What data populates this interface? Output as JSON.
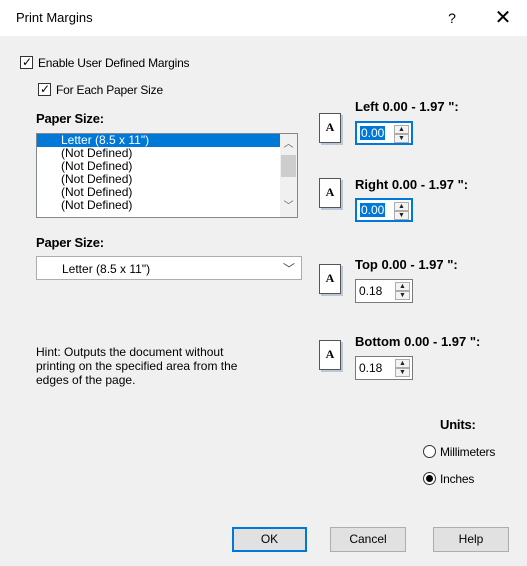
{
  "window": {
    "title": "Print Margins",
    "help_glyph": "?",
    "close_glyph": "✕"
  },
  "options": {
    "enable_user_margins": {
      "label": "Enable User Defined Margins",
      "checked": true
    },
    "for_each_paper_size": {
      "label": "For Each Paper Size",
      "checked": true
    }
  },
  "paper_list": {
    "label": "Paper Size:",
    "items": [
      "Letter (8.5 x 11\")",
      "(Not Defined)",
      "(Not Defined)",
      "(Not Defined)",
      "(Not Defined)",
      "(Not Defined)"
    ],
    "selected_index": 0
  },
  "paper_combo": {
    "label": "Paper Size:",
    "value": "Letter (8.5 x 11\")"
  },
  "margins": {
    "left": {
      "label": "Left 0.00 - 1.97 \":",
      "value": "0.00",
      "icon_letter": "A"
    },
    "right": {
      "label": "Right 0.00 - 1.97 \":",
      "value": "0.00",
      "icon_letter": "A"
    },
    "top": {
      "label": "Top 0.00 - 1.97 \":",
      "value": "0.18",
      "icon_letter": "A"
    },
    "bottom": {
      "label": "Bottom 0.00 - 1.97 \":",
      "value": "0.18",
      "icon_letter": "A"
    }
  },
  "hint": "Hint: Outputs the document without printing on the specified area from the edges of the page.",
  "units": {
    "label": "Units:",
    "millimeters": {
      "label": "Millimeters",
      "selected": false
    },
    "inches": {
      "label": "Inches",
      "selected": true
    }
  },
  "buttons": {
    "ok": "OK",
    "cancel": "Cancel",
    "help": "Help"
  },
  "colors": {
    "accent": "#0078d7",
    "dialog_bg": "#f0f0f0"
  }
}
